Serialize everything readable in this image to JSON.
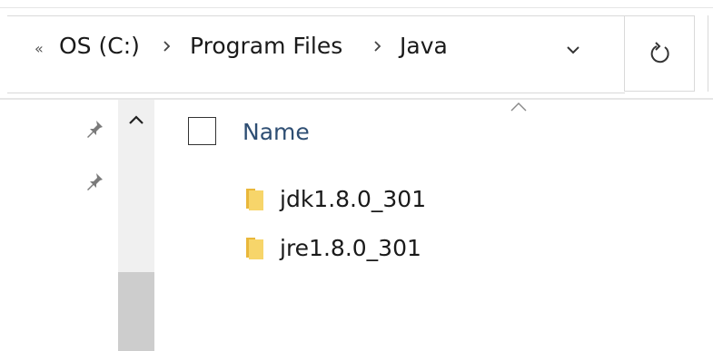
{
  "breadcrumb": {
    "overflow_label": "«",
    "items": [
      "OS (C:)",
      "Program Files",
      "Java"
    ]
  },
  "file_list": {
    "column_name_label": "Name",
    "items": [
      {
        "name": "jdk1.8.0_301",
        "type": "folder"
      },
      {
        "name": "jre1.8.0_301",
        "type": "folder"
      }
    ]
  },
  "colors": {
    "folder": "#f2c54e",
    "column_header_text": "#2e4e73",
    "scroll_thumb": "#cdcdcd"
  },
  "icons": {
    "breadcrumb_separator": "chevron-right-icon",
    "history_dropdown": "chevron-down-icon",
    "refresh": "refresh-icon",
    "pin": "pin-icon",
    "sort": "sort-ascending-icon"
  }
}
